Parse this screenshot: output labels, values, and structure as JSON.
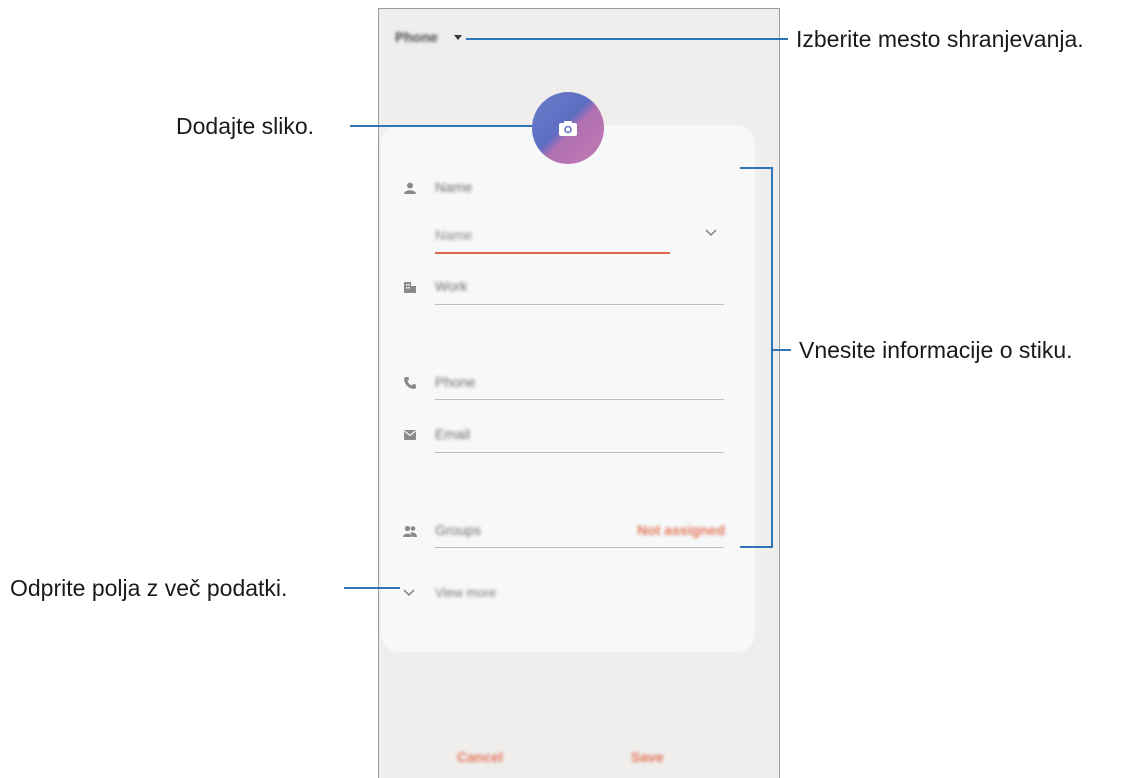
{
  "callouts": {
    "storage": "Izberite mesto shranjevanja.",
    "photo": "Dodajte sliko.",
    "info": "Vnesite informacije o stiku.",
    "more": "Odprite polja z več podatki."
  },
  "phone": {
    "storage_label": "Phone",
    "fields": {
      "name": "Name",
      "name_sub": "Name",
      "work": "Work",
      "phone": "Phone",
      "email": "Email",
      "groups": "Groups",
      "groups_value": "Not assigned",
      "view_more": "View more"
    },
    "buttons": {
      "cancel": "Cancel",
      "save": "Save"
    }
  },
  "colors": {
    "accent": "#e57559",
    "callout_line": "#2f75b6"
  }
}
